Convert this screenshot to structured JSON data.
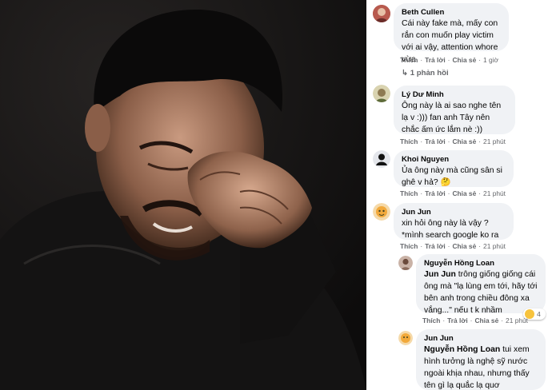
{
  "comments": [
    {
      "author": "Beth Cullen",
      "text": "Cái này fake mà, mấy con rắn con muốn play victim với ai vậy, attention whore vừa",
      "actions": {
        "like": "Thích",
        "reply": "Trả lời",
        "share": "Chia sẻ",
        "time": "1 giờ"
      },
      "replies_link": "1 phản hồi"
    },
    {
      "author": "Lý Dư Minh",
      "text": "Ông này là ai sao nghe tên lạ v :))) fan anh Tây nên chắc ấm ức lắm nè :))",
      "actions": {
        "like": "Thích",
        "reply": "Trả lời",
        "share": "Chia sẻ",
        "time": "21 phút"
      }
    },
    {
      "author": "Khoi Nguyen",
      "text": "Ủa ông này mà cũng sân si ghê v hả?",
      "emoji": "🤔",
      "actions": {
        "like": "Thích",
        "reply": "Trả lời",
        "share": "Chia sẻ",
        "time": "21 phút"
      }
    },
    {
      "author": "Jun Jun",
      "text": "xin hỏi ông này là vậy ? *mình search google ko ra",
      "actions": {
        "like": "Thích",
        "reply": "Trả lời",
        "share": "Chia sẻ",
        "time": "21 phút"
      }
    },
    {
      "author": "Nguyễn Hồng Loan",
      "mention": "Jun Jun",
      "text": " trông giống giống cái ông mà \"lạ lùng em tới, hãy tới bên anh trong chiều đông xa vắng...\" nếu t k nhầm",
      "actions": {
        "like": "Thích",
        "reply": "Trả lời",
        "share": "Chia sẻ",
        "time": "21 phút"
      },
      "reaction_count": "4"
    },
    {
      "author": "Jun Jun",
      "mention": "Nguyễn Hồng Loan",
      "text": " tui xem hình tưởng là nghệ sỹ nước ngoài khịa nhau, nhưng thấy tên gì lạ quắc lạ quơ"
    }
  ],
  "colors": {
    "bubble_bg": "#f0f2f5",
    "meta_text": "#65676b",
    "main_text": "#050505"
  }
}
